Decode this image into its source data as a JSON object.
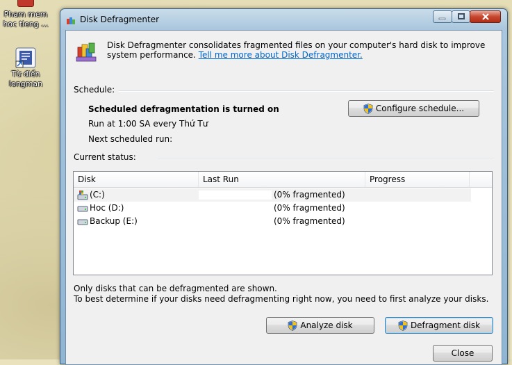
{
  "desktop": {
    "icons": [
      {
        "label_line1": "Pham mem",
        "label_line2": "hoc tieng ..."
      },
      {
        "label_line1": "Từ điển",
        "label_line2": "longman"
      }
    ]
  },
  "window": {
    "title": "Disk Defragmenter",
    "controls": {
      "minimize": "minimize",
      "maximize": "maximize",
      "close": "close"
    }
  },
  "intro": {
    "text": "Disk Defragmenter consolidates fragmented files on your computer's hard disk to improve system performance.",
    "link": "Tell me more about Disk Defragmenter."
  },
  "schedule": {
    "label": "Schedule:",
    "status": "Scheduled defragmentation is turned on",
    "run_at": "Run at 1:00 SA every Thứ Tư",
    "next_run": "Next scheduled run:",
    "configure_button": "Configure schedule..."
  },
  "current_status": {
    "label": "Current status:",
    "columns": [
      "Disk",
      "Last Run",
      "Progress"
    ],
    "rows": [
      {
        "disk": "(C:)",
        "last_run": "(0% fragmented)",
        "progress": "",
        "icon": "system-drive-icon"
      },
      {
        "disk": "Hoc (D:)",
        "last_run": "(0% fragmented)",
        "progress": "",
        "icon": "drive-icon"
      },
      {
        "disk": "Backup (E:)",
        "last_run": "(0% fragmented)",
        "progress": "",
        "icon": "drive-icon"
      }
    ]
  },
  "notes": {
    "line1": "Only disks that can be defragmented are shown.",
    "line2": "To best determine if your disks need defragmenting right now, you need to first analyze your disks."
  },
  "buttons": {
    "analyze": "Analyze disk",
    "defragment": "Defragment disk",
    "close": "Close"
  }
}
